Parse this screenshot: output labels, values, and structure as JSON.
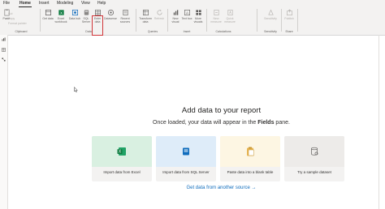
{
  "menu": {
    "file": "File",
    "home": "Home",
    "insert": "Insert",
    "modeling": "Modeling",
    "view": "View",
    "help": "Help"
  },
  "ribbon": {
    "clipboard": {
      "paste": "Paste",
      "cut": "Cut",
      "copy": "Copy",
      "format_painter": "Format painter",
      "group": "Clipboard"
    },
    "data": {
      "get_data": "Get data",
      "excel_workbook": "Excel workbook",
      "data_hub": "Data hub",
      "sql_server": "SQL Server",
      "enter_data": "Enter data",
      "dataverse": "Dataverse",
      "recent_sources": "Recent sources",
      "group": "Data"
    },
    "queries": {
      "transform_data": "Transform data",
      "refresh": "Refresh",
      "group": "Queries"
    },
    "insert": {
      "new_visual": "New visual",
      "text_box": "Text box",
      "more_visuals": "More visuals",
      "group": "Insert"
    },
    "calculations": {
      "new_measure": "New measure",
      "quick_measure": "Quick measure",
      "group": "Calculations"
    },
    "sensitivity": {
      "sensitivity": "Sensitivity",
      "group": "Sensitivity"
    },
    "share": {
      "publish": "Publish",
      "group": "Share"
    }
  },
  "main": {
    "title": "Add data to your report",
    "subtitle_prefix": "Once loaded, your data will appear in the",
    "subtitle_bold": "Fields",
    "subtitle_suffix": "pane.",
    "cards": [
      {
        "label": "Import data from Excel",
        "color": "#d9f0e1",
        "icon": "excel-icon"
      },
      {
        "label": "Import data from SQL Server",
        "color": "#deecf9",
        "icon": "sql-server-icon"
      },
      {
        "label": "Paste data into a blank table",
        "color": "#fdf6e3",
        "icon": "paste-icon"
      },
      {
        "label": "Try a sample dataset",
        "color": "#edebe9",
        "icon": "sample-dataset-icon"
      }
    ],
    "link": "Get data from another source →"
  }
}
